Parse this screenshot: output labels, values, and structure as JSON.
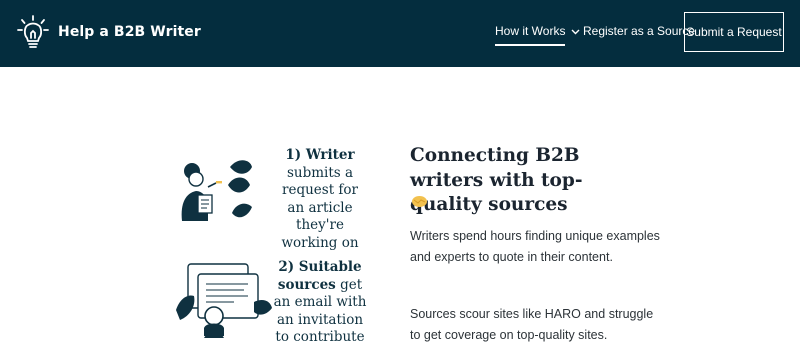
{
  "nav": {
    "brand": "Help a B2B Writer",
    "brand_icon": "lightbulb-icon",
    "how_it_works": "How it Works",
    "register": "Register as a Source",
    "submit": "Submit a Request"
  },
  "steps": [
    {
      "number": "1) Writer",
      "rest": "submits a request for an article they're working on",
      "illustration": "writer-illustration"
    },
    {
      "number": "2) Suitable sources",
      "rest": "get an email with an invitation to contribute",
      "illustration": "sources-illustration"
    }
  ],
  "intro": {
    "heading": "Connecting B2B writers with top-quality sources",
    "emoji": "handshake-emoji",
    "paragraphs": [
      "Writers spend hours finding unique examples and experts to quote in their content.",
      "Sources scour sites like HARO and struggle to get coverage on top-quality sites."
    ]
  },
  "colors": {
    "nav_bg": "#042d3e",
    "text_dark": "#0f3140",
    "accent": "#f2c14e"
  }
}
